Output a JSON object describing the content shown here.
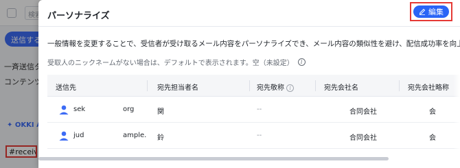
{
  "background": {
    "search_text": "検索キ",
    "send_button": "送信する",
    "text_line_1": "一斉送信タス",
    "text_line_2": "コンテンツの",
    "okki_label": "OKKI AI",
    "receiver_tag": "#receiver"
  },
  "modal": {
    "title": "パーソナライズ",
    "edit_button": "編集",
    "edit_icon": "pencil-icon",
    "description": "一般情報を変更することで、受信者が受け取るメール内容をパーソナライズでき、メール内容の類似性を避け、配信成功率を向上させることができます",
    "note": "受取人のニックネームがない場合は、デフォルトで表示されます。空（未設定）",
    "accent_color": "#2a64f6",
    "highlight_color": "#e53935"
  },
  "table": {
    "headers": [
      "送信先",
      "宛先担当者名",
      "宛先敬称",
      "宛先会社名",
      "宛先会社略称"
    ],
    "rows": [
      {
        "recipient": "sek",
        "recipient_domain": "org",
        "contact_name": "関",
        "honorific": "--",
        "company": "合同会社",
        "company_short": "会"
      },
      {
        "recipient": "jud",
        "recipient_domain": "ample.",
        "contact_name": "鈴",
        "honorific": "--",
        "company": "合同会社",
        "company_short": "会"
      }
    ]
  }
}
